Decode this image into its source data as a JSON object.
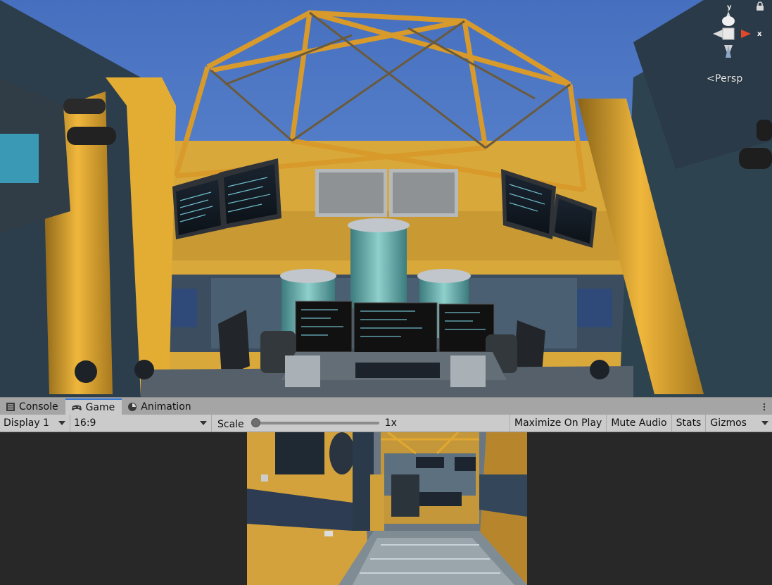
{
  "scene": {
    "projection_label": "Persp",
    "gizmo": {
      "y_axis": "y",
      "x_axis": "x"
    }
  },
  "tabs": [
    {
      "label": "Console",
      "icon": "console-icon",
      "active": false
    },
    {
      "label": "Game",
      "icon": "gamepad-icon",
      "active": true
    },
    {
      "label": "Animation",
      "icon": "animation-clock-icon",
      "active": false
    }
  ],
  "toolbar": {
    "display": "Display 1",
    "aspect": "16:9",
    "scale_label": "Scale",
    "scale_value": "1x",
    "scale_level": 0,
    "maximize_on_play": "Maximize On Play",
    "mute_audio": "Mute Audio",
    "stats": "Stats",
    "gizmos": "Gizmos"
  },
  "colors": {
    "sky": "#4a77c4",
    "accent_tab": "#3a79d1",
    "structure_yellow": "#e0a830",
    "editor_dark": "#282828",
    "panel_light": "#cbcbcb",
    "tab_bar": "#a5a5a5"
  }
}
